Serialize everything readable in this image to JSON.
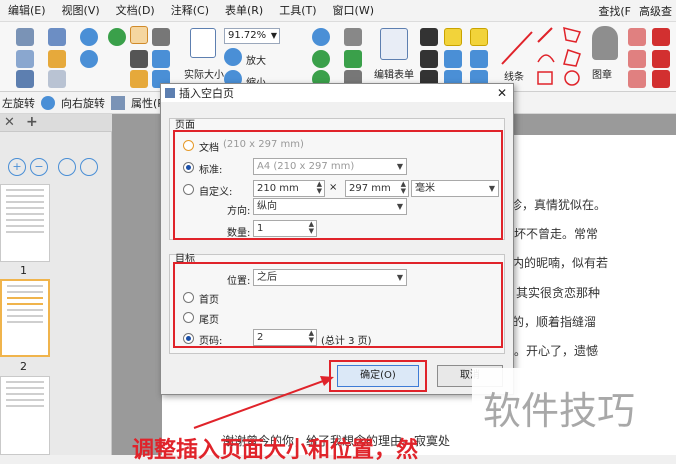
{
  "menubar": {
    "items": [
      "编辑(E)",
      "视图(V)",
      "文档(D)",
      "注释(C)",
      "表单(R)",
      "工具(T)",
      "窗口(W)"
    ],
    "find": "查找(F",
    "advanced": "高级查"
  },
  "ribbon": {
    "zoom_value": "91.72%",
    "zoom_in": "放大",
    "zoom_out": "缩小",
    "actual_size": "实际大小",
    "edit_form": "编辑表单",
    "line": "线条",
    "stamp": "图章"
  },
  "toolbar2": {
    "rotate_left": "左旋转",
    "rotate_right": "向右旋转",
    "properties": "属性(P)..."
  },
  "thumbnails": {
    "page1": "1",
    "page2": "2"
  },
  "document": {
    "lines": [
      "诊，真情犹似在。",
      "坏不曾走。常常",
      "内的昵喃，似有若",
      "其实很贪恋那种",
      "的，顺着指缝溜",
      "。开心了，遗憾",
      "谢谢曾今的你，给了我想念的理由。寂寞处"
    ]
  },
  "dialog": {
    "title": "插入空白页",
    "page_group": "页面",
    "doc_label": "文档",
    "doc_size": "(210 x 297 mm)",
    "standard_label": "标准:",
    "standard_value": "A4 (210 x 297 mm)",
    "custom_label": "自定义:",
    "width_value": "210 mm",
    "times": "×",
    "height_value": "297 mm",
    "unit_value": "毫米",
    "orientation_label": "方向:",
    "orientation_value": "纵向",
    "count_label": "数量:",
    "count_value": "1",
    "target_group": "目标",
    "position_label": "位置:",
    "position_value": "之后",
    "first_page": "首页",
    "last_page": "尾页",
    "page_num_label": "页码:",
    "page_num_value": "2",
    "total_pages": "(总计 3 页)",
    "ok": "确定(O)",
    "cancel": "取消"
  },
  "annotation": {
    "caption": "调整插入页面大小和位置，然"
  },
  "watermark": "软件技巧",
  "colors": {
    "highlight_red": "#e0232a",
    "radio_blue": "#1a4fa8"
  }
}
